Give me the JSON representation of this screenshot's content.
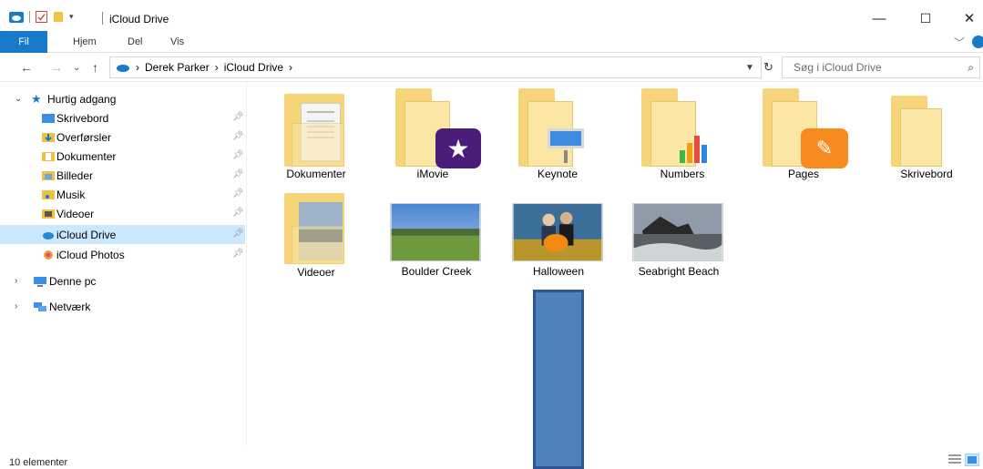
{
  "window": {
    "title": "iCloud Drive",
    "controls": {
      "minimize": "—",
      "maximize": "☐",
      "close": "✕"
    }
  },
  "ribbon": {
    "file_tab": "Fil",
    "tabs": [
      "Hjem",
      "Del",
      "Vis"
    ]
  },
  "address": {
    "breadcrumb": [
      "Derek Parker",
      "iCloud Drive"
    ],
    "search_placeholder": "Søg i iCloud Drive"
  },
  "nav": {
    "quick_access": "Hurtig adgang",
    "quick_items": [
      {
        "label": "Skrivebord",
        "icon": "desktop-icon"
      },
      {
        "label": "Overførsler",
        "icon": "downloads-icon"
      },
      {
        "label": "Dokumenter",
        "icon": "documents-icon"
      },
      {
        "label": "Billeder",
        "icon": "pictures-icon"
      },
      {
        "label": "Musik",
        "icon": "music-icon"
      },
      {
        "label": "Videoer",
        "icon": "videos-icon"
      },
      {
        "label": "iCloud Drive",
        "icon": "icloud-icon",
        "selected": true
      },
      {
        "label": "iCloud Photos",
        "icon": "photos-icon"
      }
    ],
    "this_pc": "Denne pc",
    "network": "Netværk"
  },
  "items": [
    {
      "label": "Dokumenter",
      "kind": "folder"
    },
    {
      "label": "iMovie",
      "kind": "folder-app"
    },
    {
      "label": "Keynote",
      "kind": "folder-app"
    },
    {
      "label": "Numbers",
      "kind": "folder-app"
    },
    {
      "label": "Pages",
      "kind": "folder-app"
    },
    {
      "label": "Skrivebord",
      "kind": "folder"
    },
    {
      "label": "Videoer",
      "kind": "folder"
    },
    {
      "label": "Boulder Creek",
      "kind": "photo"
    },
    {
      "label": "Halloween",
      "kind": "photo"
    },
    {
      "label": "Seabright Beach",
      "kind": "photo"
    }
  ],
  "status": {
    "count": "10 elementer"
  },
  "colors": {
    "accent": "#1979ca",
    "selection": "#cce8ff",
    "folder": "#f5d47a",
    "annotation": "#4f81bd"
  }
}
